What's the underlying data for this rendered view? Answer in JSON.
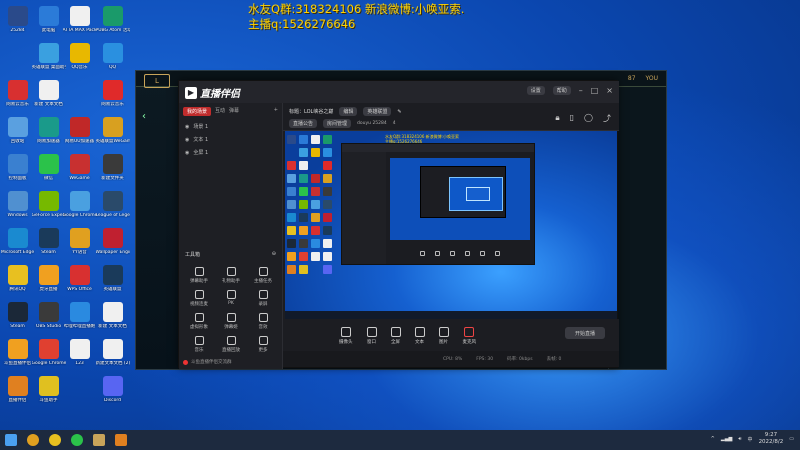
{
  "overlay": {
    "line1": "水友Q群:318324106 新浪微博:小唤亚索.",
    "line2": "主播q:1526276646"
  },
  "desktop": {
    "icons": [
      {
        "label": "25284",
        "color": "#2a4a8a"
      },
      {
        "label": "此电脑",
        "color": "#2b7bd8"
      },
      {
        "label": "ATTA MAX Pack",
        "color": "#f0f0f0"
      },
      {
        "label": "PUBG Atom 活动服",
        "color": "#1a9a6a"
      },
      {
        "label": "",
        "color": "transparent"
      },
      {
        "label": "英雄联盟 桌面助手",
        "color": "#3aa0e0"
      },
      {
        "label": "QQ音乐",
        "color": "#e8b800"
      },
      {
        "label": "QQ",
        "color": "#2a90e0"
      },
      {
        "label": "网易云音乐",
        "color": "#d83030"
      },
      {
        "label": "新建 文本文档",
        "color": "#f0f0f0"
      },
      {
        "label": "",
        "color": "transparent"
      },
      {
        "label": "网易云音乐",
        "color": "#e02a2a"
      },
      {
        "label": "回收站",
        "color": "#5aa0e0"
      },
      {
        "label": "网易加速器",
        "color": "#1a9a8a"
      },
      {
        "label": "网易UU加速器",
        "color": "#c02828"
      },
      {
        "label": "英雄联盟WeGame",
        "color": "#d8a020"
      },
      {
        "label": "控制面板",
        "color": "#3a80d0"
      },
      {
        "label": "微信",
        "color": "#2bc24a"
      },
      {
        "label": "WeGame",
        "color": "#c83030"
      },
      {
        "label": "新建文件夹",
        "color": "#3a3a3a"
      },
      {
        "label": "Windows",
        "color": "#5090d0"
      },
      {
        "label": "GeForce Experience",
        "color": "#76b900"
      },
      {
        "label": "Google Chrome",
        "color": "#4aa0e0"
      },
      {
        "label": "League of Legends",
        "color": "#2a4a6a"
      },
      {
        "label": "Microsoft Edge",
        "color": "#1a8ad0"
      },
      {
        "label": "Steam",
        "color": "#1a3a5a"
      },
      {
        "label": "YY语音",
        "color": "#e0a020"
      },
      {
        "label": "Wallpaper Engine",
        "color": "#c02030"
      },
      {
        "label": "腾讯QQ",
        "color": "#e8c020"
      },
      {
        "label": "虎牙直播",
        "color": "#f0a020"
      },
      {
        "label": "WPS Office",
        "color": "#d83030"
      },
      {
        "label": "英雄联盟",
        "color": "#1a3a5a"
      },
      {
        "label": "Steam",
        "color": "#1b2838"
      },
      {
        "label": "OBS Studio",
        "color": "#3a3a3a"
      },
      {
        "label": "哔哩哔哩直播姬",
        "color": "#2a8ae0"
      },
      {
        "label": "新建 文本文档",
        "color": "#f0f0f0"
      },
      {
        "label": "斗鱼直播伴侣",
        "color": "#f0a020"
      },
      {
        "label": "Google Chrome",
        "color": "#e04030"
      },
      {
        "label": "123",
        "color": "#f0f0f0"
      },
      {
        "label": "新建文本文档 (2)",
        "color": "#f0f0f0"
      },
      {
        "label": "直播伴侣",
        "color": "#e08020"
      },
      {
        "label": "斗鱼助手",
        "color": "#e0c020"
      },
      {
        "label": "",
        "color": "transparent"
      },
      {
        "label": "Discord",
        "color": "#5865f2"
      }
    ]
  },
  "game_client": {
    "logo": "L",
    "right_tabs": [
      "87",
      "YOU"
    ]
  },
  "app": {
    "brand": "直播伴侣",
    "title_pills": [
      "设置",
      "帮助"
    ],
    "left_tabs": [
      "我的场景",
      "互动",
      "弹幕",
      "+"
    ],
    "scenes": [
      "场景 1",
      "文本 1",
      "全屏 1"
    ],
    "tools_title": "工具箱",
    "tools": [
      "弹幕助手",
      "礼物助手",
      "主播任务",
      "视频连麦",
      "PK",
      "录屏",
      "虚拟形象",
      "弹幕姬",
      "音效",
      "音乐",
      "直播回放",
      "更多"
    ],
    "bottom_note": "斗鱼直播伴侣交流群",
    "head": {
      "title": "标题：LOL峡谷之巅",
      "edit_label": "编辑",
      "category": "英雄联盟",
      "notice_label": "直播公告",
      "room_label": "房间管理",
      "room_id": "douyu 25284",
      "fans": "4"
    },
    "preview_text1": "水友Q群:318324106 新浪微博:小唤亚索",
    "preview_text2": "主播q:1526276646",
    "controls": [
      "摄像头",
      "窗口",
      "全屏",
      "文本",
      "图片",
      "麦克风"
    ],
    "start_label": "开始直播",
    "status": [
      "CPU: 8%",
      "FPS: 30",
      "码率: 0kbps",
      "丢帧: 0"
    ]
  },
  "taskbar": {
    "time": "9:27",
    "date": "2022/8/2"
  }
}
